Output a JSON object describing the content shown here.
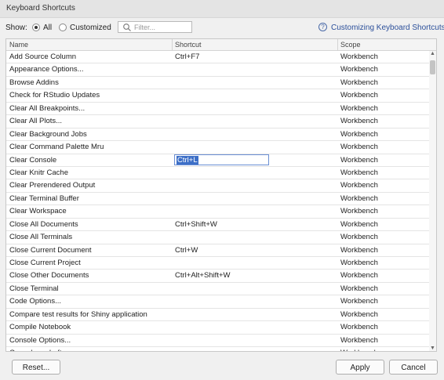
{
  "window": {
    "title": "Keyboard Shortcuts"
  },
  "filter": {
    "show_label": "Show:",
    "options": [
      {
        "label": "All",
        "checked": true
      },
      {
        "label": "Customized",
        "checked": false
      }
    ],
    "search_placeholder": "Filter...",
    "search_icon": "magnifier-icon"
  },
  "help": {
    "icon": "question-circle-icon",
    "link_text": "Customizing Keyboard Shortcuts"
  },
  "table": {
    "columns": [
      "Name",
      "Shortcut",
      "Scope"
    ],
    "rows": [
      {
        "name": "Add Source Column",
        "shortcut": "Ctrl+F7",
        "scope": "Workbench"
      },
      {
        "name": "Appearance Options...",
        "shortcut": "",
        "scope": "Workbench"
      },
      {
        "name": "Browse Addins",
        "shortcut": "",
        "scope": "Workbench"
      },
      {
        "name": "Check for RStudio Updates",
        "shortcut": "",
        "scope": "Workbench"
      },
      {
        "name": "Clear All Breakpoints...",
        "shortcut": "",
        "scope": "Workbench"
      },
      {
        "name": "Clear All Plots...",
        "shortcut": "",
        "scope": "Workbench"
      },
      {
        "name": "Clear Background Jobs",
        "shortcut": "",
        "scope": "Workbench"
      },
      {
        "name": "Clear Command Palette Mru",
        "shortcut": "",
        "scope": "Workbench"
      },
      {
        "name": "Clear Console",
        "shortcut": "Ctrl+L",
        "scope": "Workbench",
        "editing": true
      },
      {
        "name": "Clear Knitr Cache",
        "shortcut": "",
        "scope": "Workbench"
      },
      {
        "name": "Clear Prerendered Output",
        "shortcut": "",
        "scope": "Workbench"
      },
      {
        "name": "Clear Terminal Buffer",
        "shortcut": "",
        "scope": "Workbench"
      },
      {
        "name": "Clear Workspace",
        "shortcut": "",
        "scope": "Workbench"
      },
      {
        "name": "Close All Documents",
        "shortcut": "Ctrl+Shift+W",
        "scope": "Workbench"
      },
      {
        "name": "Close All Terminals",
        "shortcut": "",
        "scope": "Workbench"
      },
      {
        "name": "Close Current Document",
        "shortcut": "Ctrl+W",
        "scope": "Workbench"
      },
      {
        "name": "Close Current Project",
        "shortcut": "",
        "scope": "Workbench"
      },
      {
        "name": "Close Other Documents",
        "shortcut": "Ctrl+Alt+Shift+W",
        "scope": "Workbench"
      },
      {
        "name": "Close Terminal",
        "shortcut": "",
        "scope": "Workbench"
      },
      {
        "name": "Code Options...",
        "shortcut": "",
        "scope": "Workbench"
      },
      {
        "name": "Compare test results for Shiny application",
        "shortcut": "",
        "scope": "Workbench"
      },
      {
        "name": "Compile Notebook",
        "shortcut": "",
        "scope": "Workbench"
      },
      {
        "name": "Console Options...",
        "shortcut": "",
        "scope": "Workbench"
      },
      {
        "name": "Console on Left",
        "shortcut": "",
        "scope": "Workbench"
      }
    ]
  },
  "buttons": {
    "reset": "Reset...",
    "apply": "Apply",
    "cancel": "Cancel"
  }
}
